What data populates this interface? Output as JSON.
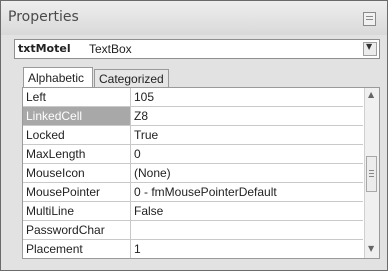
{
  "window": {
    "title": "Properties"
  },
  "object_selector": {
    "name": "txtMotel",
    "type": "TextBox"
  },
  "tabs": [
    {
      "label": "Alphabetic",
      "active": true
    },
    {
      "label": "Categorized",
      "active": false
    }
  ],
  "properties": [
    {
      "name": "Left",
      "value": "105"
    },
    {
      "name": "LinkedCell",
      "value": "Z8",
      "selected": true
    },
    {
      "name": "Locked",
      "value": "True"
    },
    {
      "name": "MaxLength",
      "value": "0"
    },
    {
      "name": "MouseIcon",
      "value": "(None)"
    },
    {
      "name": "MousePointer",
      "value": "0 - fmMousePointerDefault"
    },
    {
      "name": "MultiLine",
      "value": "False"
    },
    {
      "name": "PasswordChar",
      "value": ""
    },
    {
      "name": "Placement",
      "value": "1"
    }
  ],
  "icons": {
    "pin": "pin-icon",
    "dropdown": "chevron-down-icon",
    "scroll_up": "arrow-up-icon",
    "scroll_down": "arrow-down-icon"
  }
}
